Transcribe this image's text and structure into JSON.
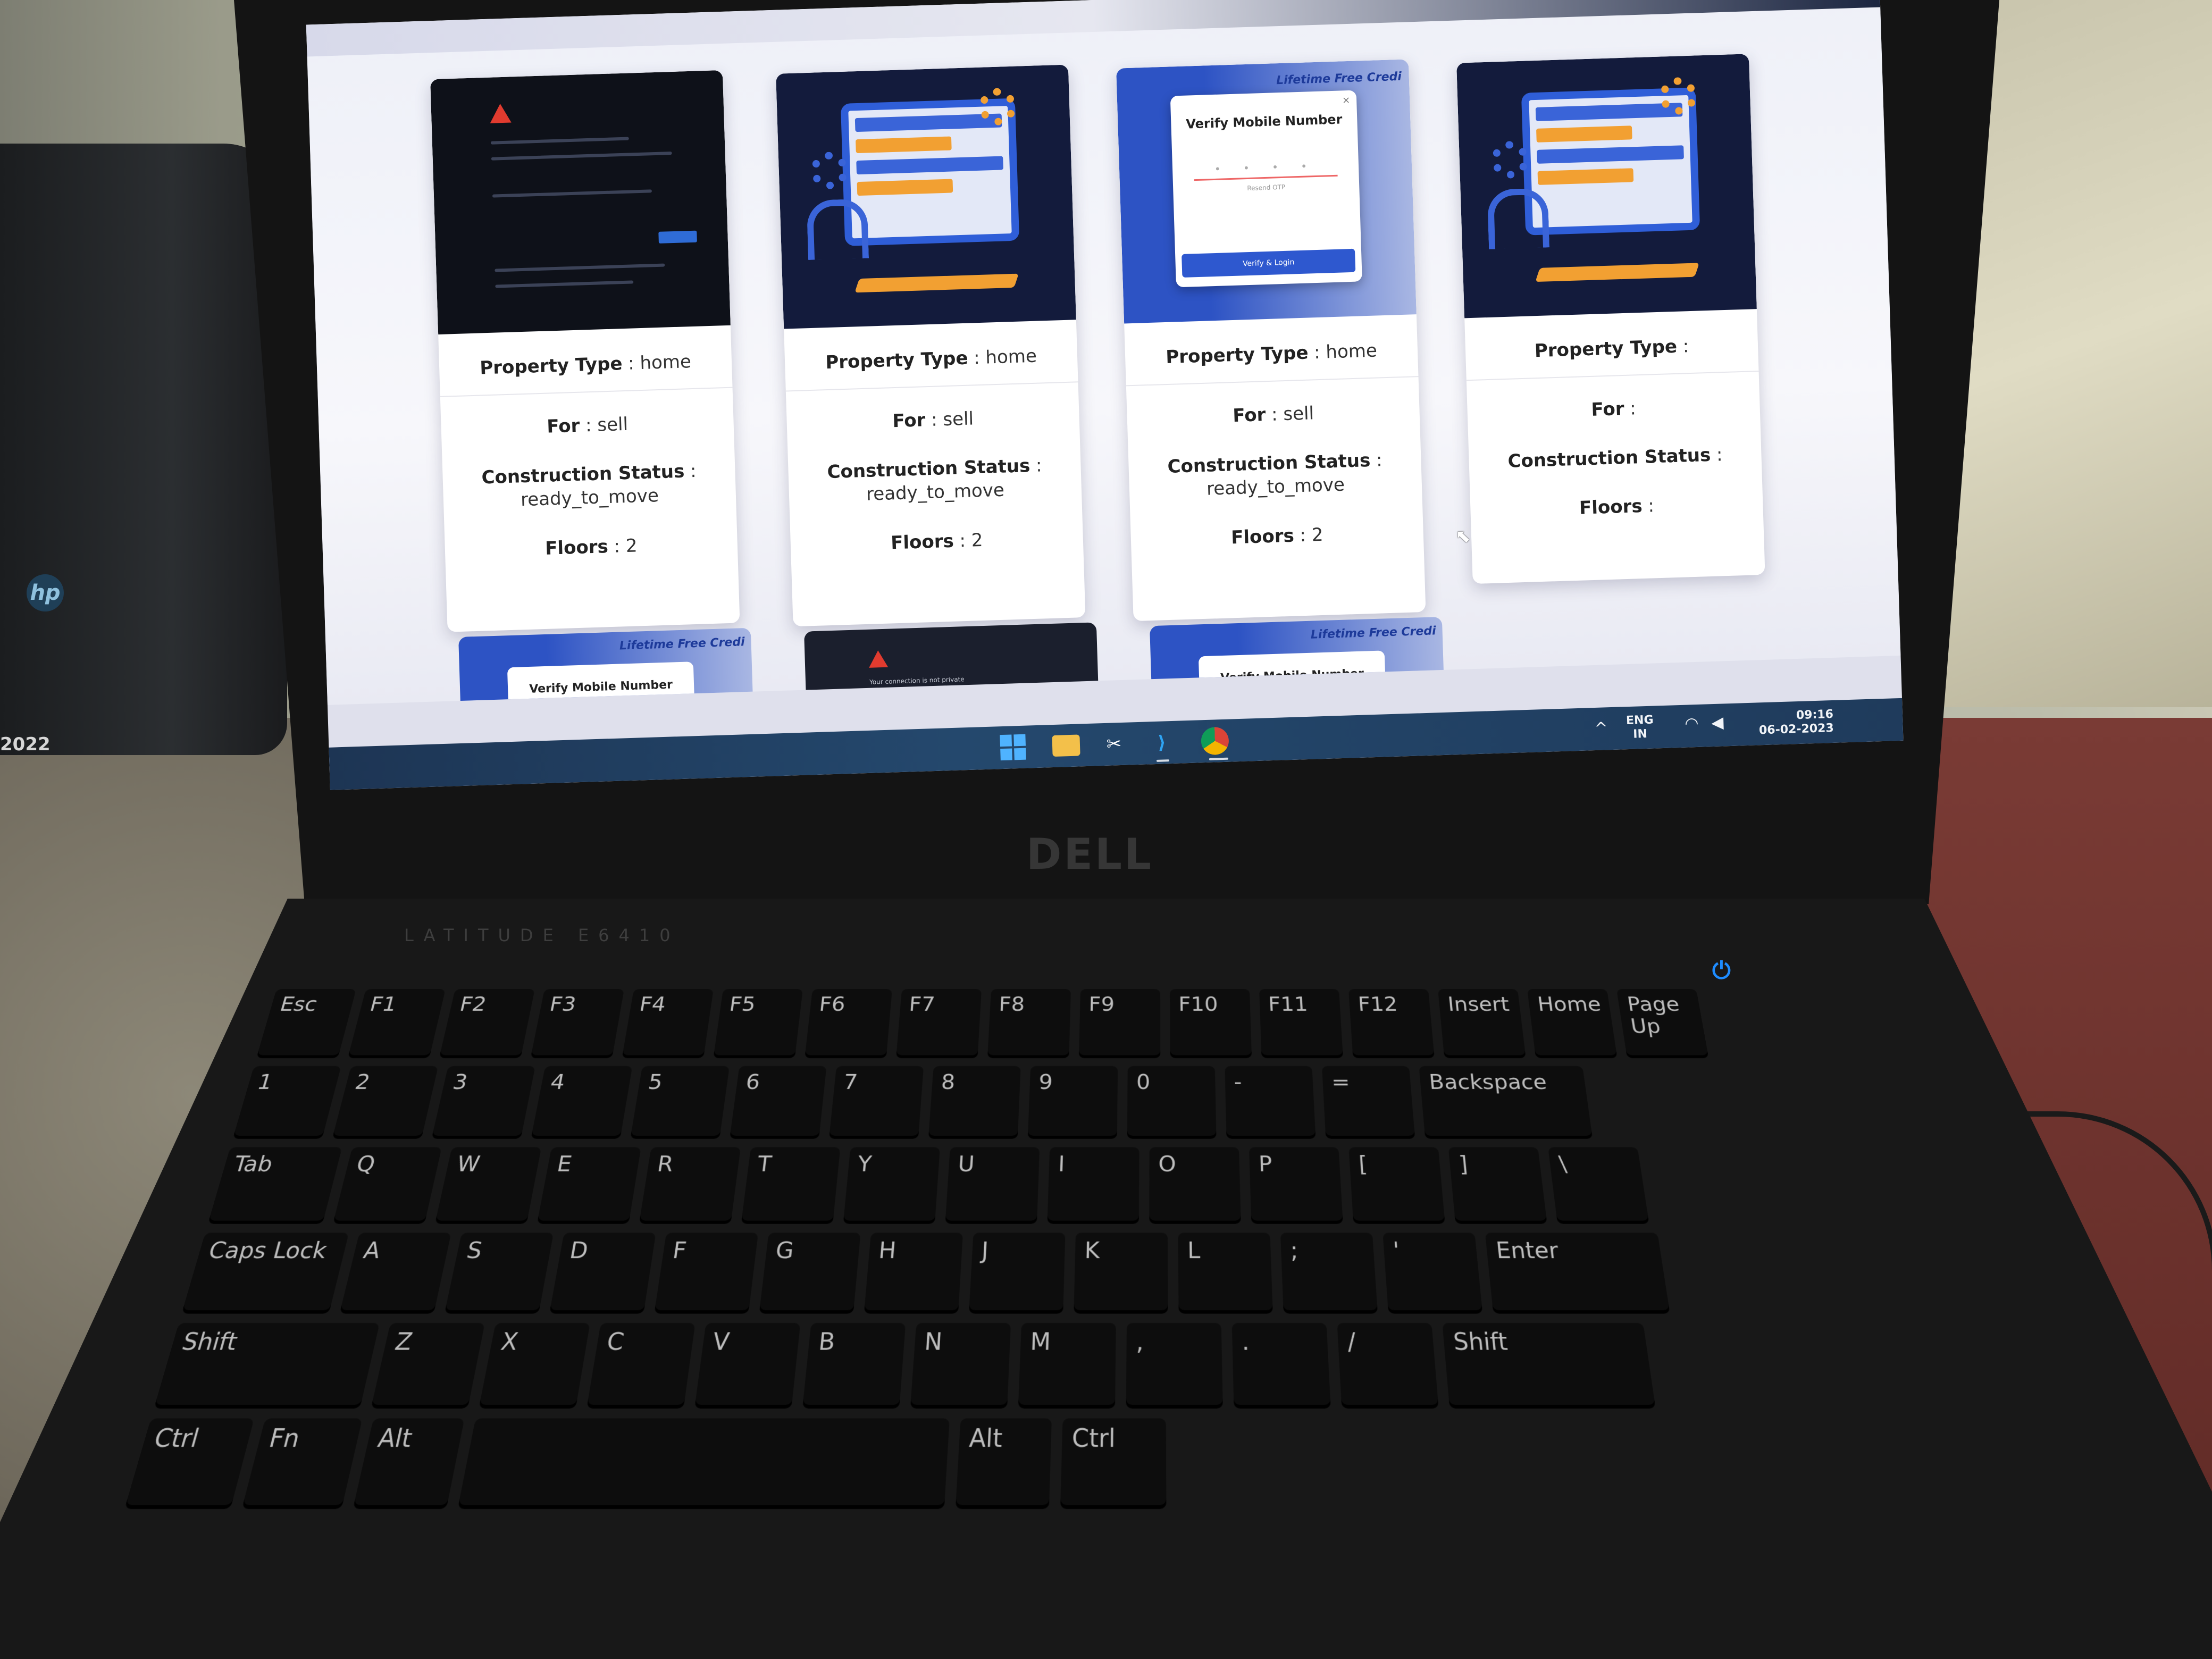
{
  "cards": [
    {
      "property_type_label": "Property Type",
      "property_type_value": "home",
      "for_label": "For",
      "for_value": "sell",
      "status_label": "Construction Status",
      "status_value": "ready_to_move",
      "floors_label": "Floors",
      "floors_value": "2"
    },
    {
      "property_type_label": "Property Type",
      "property_type_value": "home",
      "for_label": "For",
      "for_value": "sell",
      "status_label": "Construction Status",
      "status_value": "ready_to_move",
      "floors_label": "Floors",
      "floors_value": "2"
    },
    {
      "property_type_label": "Property Type",
      "property_type_value": "home",
      "for_label": "For",
      "for_value": "sell",
      "status_label": "Construction Status",
      "status_value": "ready_to_move",
      "floors_label": "Floors",
      "floors_value": "2"
    },
    {
      "property_type_label": "Property Type",
      "property_type_value": "",
      "for_label": "For",
      "for_value": "",
      "status_label": "Construction Status",
      "status_value": "",
      "floors_label": "Floors",
      "floors_value": ""
    }
  ],
  "thumbs": {
    "verify_title": "Verify Mobile Number",
    "verify_button": "Verify & Login",
    "resend": "Resend OTP",
    "lifetime": "Lifetime Free Credi"
  },
  "partial_cards": {
    "verify_title": "Verify Mobile Number",
    "lifetime": "Lifetime Free Credi",
    "warning_text": "Your connection is not private"
  },
  "taskbar": {
    "lang": "ENG",
    "region": "IN",
    "time": "09:16",
    "date": "06-02-2023"
  },
  "laptop": {
    "brand": "DELL",
    "model": "LATITUDE E6410",
    "backpack_year": "2022",
    "backpack_logo": "hp"
  },
  "keyboard": {
    "row1": [
      "Esc",
      "F1",
      "F2",
      "F3",
      "F4",
      "F5",
      "F6",
      "F7",
      "F8",
      "F9",
      "F10",
      "F11",
      "F12",
      "Insert",
      "Home",
      "Page Up"
    ],
    "row2": [
      "1",
      "2",
      "3",
      "4",
      "5",
      "6",
      "7",
      "8",
      "9",
      "0",
      "-",
      "=",
      "Backspace"
    ],
    "row3": [
      "Tab",
      "Q",
      "W",
      "E",
      "R",
      "T",
      "Y",
      "U",
      "I",
      "O",
      "P",
      "[",
      "]",
      "\\"
    ],
    "row4": [
      "Caps Lock",
      "A",
      "S",
      "D",
      "F",
      "G",
      "H",
      "J",
      "K",
      "L",
      ";",
      "'",
      "Enter"
    ],
    "row5": [
      "Shift",
      "Z",
      "X",
      "C",
      "V",
      "B",
      "N",
      "M",
      ",",
      ".",
      "/",
      "Shift"
    ],
    "row6": [
      "Ctrl",
      "Fn",
      "Alt",
      "",
      "Alt",
      "Ctrl"
    ]
  },
  "colors": {
    "accent": "#2e58cf",
    "warning": "#e13b2f",
    "taskbar": "#24486d"
  }
}
